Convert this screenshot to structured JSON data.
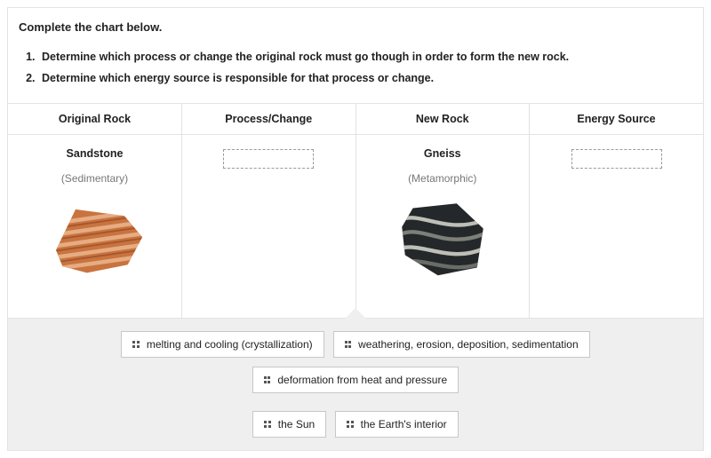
{
  "heading": "Complete the chart below.",
  "instructions": [
    "Determine which process or change the original rock must go though in order to form the new rock.",
    "Determine which energy source is responsible for that process or change."
  ],
  "table": {
    "headers": [
      "Original Rock",
      "Process/Change",
      "New Rock",
      "Energy Source"
    ],
    "original": {
      "name": "Sandstone",
      "type": "(Sedimentary)"
    },
    "new": {
      "name": "Gneiss",
      "type": "(Metamorphic)"
    }
  },
  "bank": {
    "row1": [
      "melting and cooling (crystallization)",
      "weathering, erosion, deposition, sedimentation",
      "deformation from heat and pressure"
    ],
    "row2": [
      "the Sun",
      "the Earth's interior"
    ]
  }
}
